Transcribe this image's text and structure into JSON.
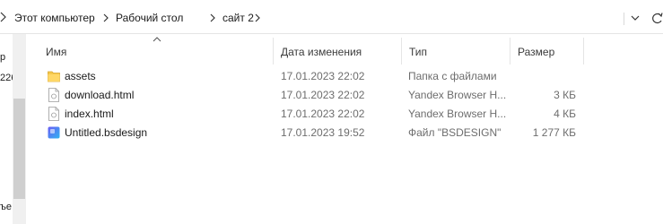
{
  "breadcrumb": {
    "items": [
      "Этот компьютер",
      "Рабочий стол",
      "сайт 2"
    ]
  },
  "nav_pane": {
    "fragments": [
      "р",
      "226",
      "ъе"
    ]
  },
  "columns": {
    "name": "Имя",
    "date": "Дата изменения",
    "type": "Тип",
    "size": "Размер"
  },
  "files": [
    {
      "name": "assets",
      "date": "17.01.2023 22:02",
      "type": "Папка с файлами",
      "size": "",
      "icon": "folder-icon"
    },
    {
      "name": "download.html",
      "date": "17.01.2023 22:02",
      "type": "Yandex Browser H...",
      "size": "3 КБ",
      "icon": "html-file-icon"
    },
    {
      "name": "index.html",
      "date": "17.01.2023 22:02",
      "type": "Yandex Browser H...",
      "size": "4 КБ",
      "icon": "html-file-icon"
    },
    {
      "name": "Untitled.bsdesign",
      "date": "17.01.2023 19:52",
      "type": "Файл \"BSDESIGN\"",
      "size": "1 277 КБ",
      "icon": "bsdesign-file-icon"
    }
  ],
  "colors": {
    "folder": "#f5c84c",
    "bsdesign_a": "#6a5cf5",
    "bsdesign_b": "#2fb4f0"
  }
}
